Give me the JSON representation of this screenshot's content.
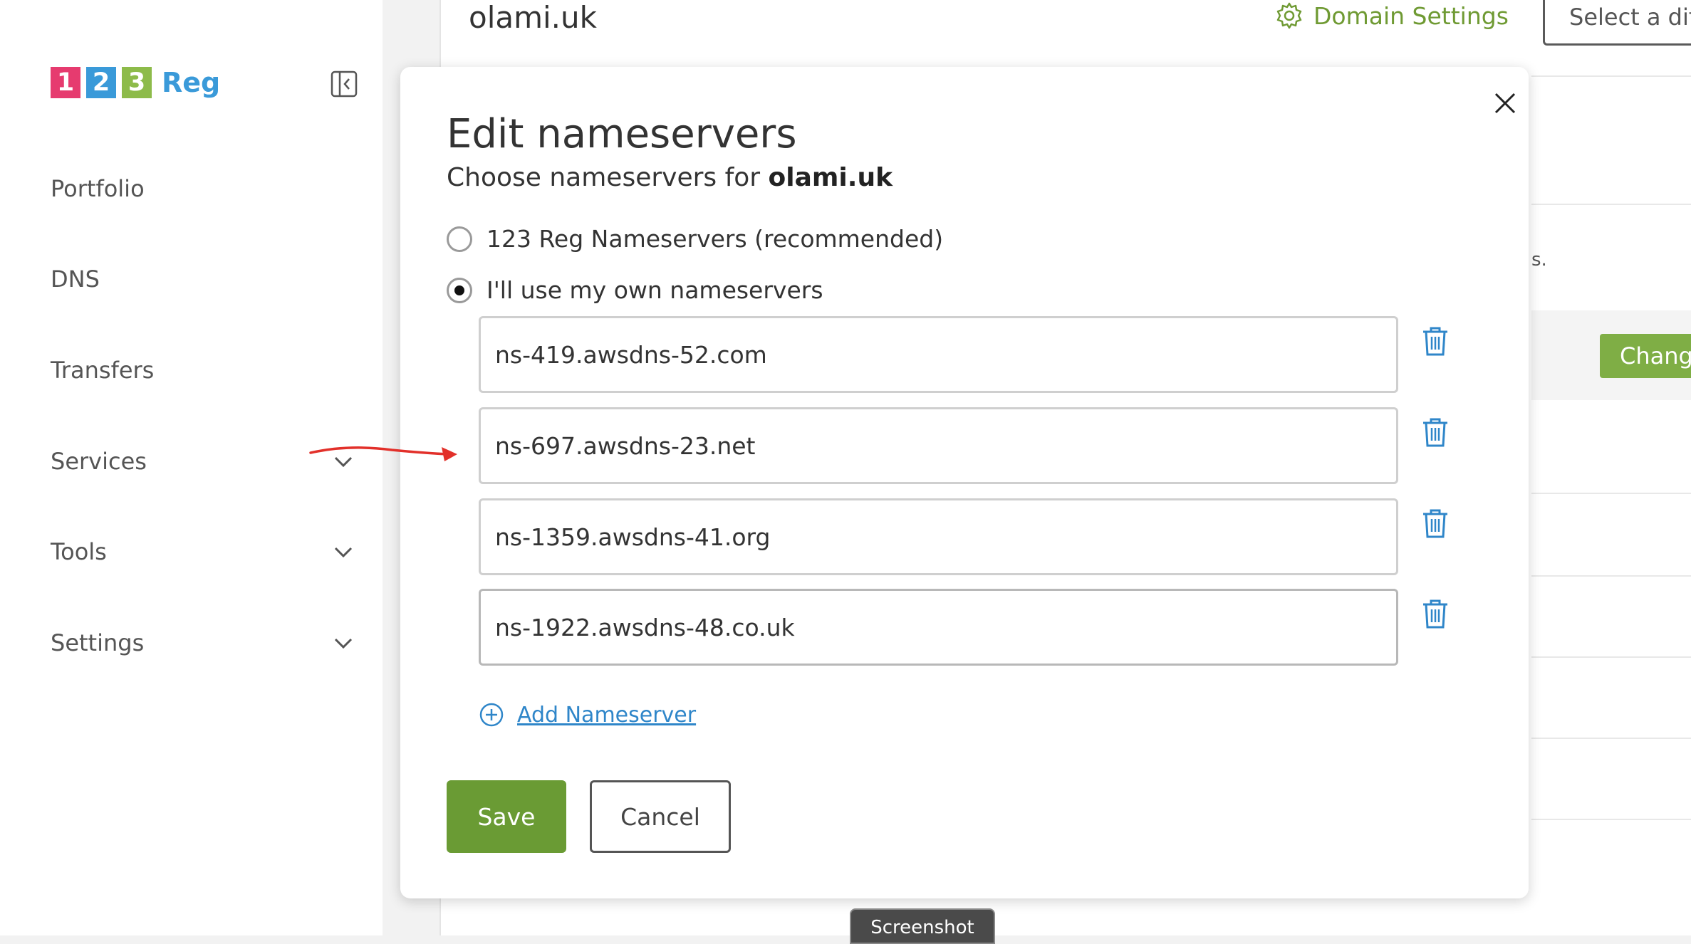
{
  "brand": {
    "tiles": [
      "1",
      "2",
      "3"
    ],
    "tile_colors": [
      "#e63b6f",
      "#3a9ad9",
      "#8dbb4a"
    ],
    "word": "Reg",
    "word_color": "#3a9ad9"
  },
  "sidebar": {
    "items": [
      {
        "label": "Portfolio",
        "has_chevron": false
      },
      {
        "label": "DNS",
        "has_chevron": false
      },
      {
        "label": "Transfers",
        "has_chevron": false
      },
      {
        "label": "Services",
        "has_chevron": true
      },
      {
        "label": "Tools",
        "has_chevron": true
      },
      {
        "label": "Settings",
        "has_chevron": true
      }
    ]
  },
  "header": {
    "domain": "olami.uk",
    "domain_settings_label": "Domain Settings",
    "select_different_label": "Select a diff"
  },
  "background": {
    "change_button_label": "Chang",
    "partial_text": "s."
  },
  "modal": {
    "title": "Edit nameservers",
    "subtitle_prefix": "Choose nameservers for ",
    "subtitle_domain": "olami.uk",
    "options": [
      {
        "label": "123 Reg Nameservers (recommended)",
        "selected": false
      },
      {
        "label": "I'll use my own nameservers",
        "selected": true
      }
    ],
    "nameservers": [
      "ns-419.awsdns-52.com",
      "ns-697.awsdns-23.net",
      "ns-1359.awsdns-41.org",
      "ns-1922.awsdns-48.co.uk"
    ],
    "add_label": "Add Nameserver",
    "save_label": "Save",
    "cancel_label": "Cancel"
  },
  "overlay": {
    "screenshot_label": "Screenshot"
  },
  "colors": {
    "accent_green": "#6a9b34",
    "link_blue": "#2f86c9",
    "annotation_red": "#e2302a"
  },
  "icons": {
    "collapse": "sidebar-collapse-icon",
    "gear": "gear-icon",
    "close": "close-icon",
    "trash": "trash-icon",
    "add": "plus-circle-icon",
    "chevron": "chevron-down-icon"
  }
}
